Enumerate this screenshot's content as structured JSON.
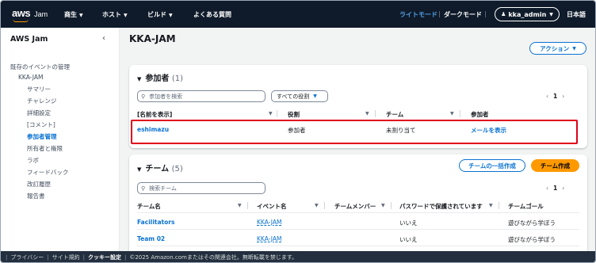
{
  "header": {
    "logo_text": "aws",
    "app_name": "Jam",
    "nav": [
      "商生",
      "ホスト",
      "ビルド",
      "よくある質問"
    ],
    "light_mode": "ライトモード",
    "dark_mode": "ダークモード",
    "user": "kka_admin",
    "language": "日本語"
  },
  "sidebar": {
    "title": "AWS Jam",
    "section": "既存のイベントの管理",
    "event": "KKA-JAM",
    "items": [
      "サマリー",
      "チャレンジ",
      "詳細設定",
      "[コメント]",
      "参加者管理",
      "所有者と権限",
      "ラボ",
      "フィードバック",
      "改訂履歴",
      "報告書"
    ],
    "active_index": 4
  },
  "page": {
    "title": "KKA-JAM",
    "actions_label": "アクション"
  },
  "participants": {
    "title": "参加者",
    "count": "(1)",
    "search_placeholder": "参加者を検索",
    "role_filter": "すべての役割",
    "page": "1",
    "columns": [
      "[名前を表示]",
      "役割",
      "チーム",
      "参加者"
    ],
    "rows": [
      {
        "name": "eshimazu",
        "role": "参加者",
        "team": "未割り当て",
        "action": "メールを表示"
      }
    ]
  },
  "teams": {
    "title": "チーム",
    "count": "(5)",
    "bulk_create": "チームの一括作成",
    "create": "チーム作成",
    "search_placeholder": "検索チーム",
    "page": "1",
    "columns": [
      "チーム名",
      "イベント名",
      "チームメンバー",
      "パスワードで保護されています",
      "チームゴール"
    ],
    "rows": [
      {
        "name": "Facilitators",
        "event": "KKA-JAM",
        "members": "",
        "protected": "いいえ",
        "goal": "遊びながら学ぼう"
      },
      {
        "name": "Team 02",
        "event": "KKA-JAM",
        "members": "",
        "protected": "いいえ",
        "goal": "遊びながら学ぼう"
      }
    ]
  },
  "footer": {
    "privacy": "プライバシー",
    "terms": "サイト規約",
    "cookie": "クッキー設定",
    "copyright": "©2025 Amazon.comまたはその関連会社。無断転載を禁じます。"
  }
}
